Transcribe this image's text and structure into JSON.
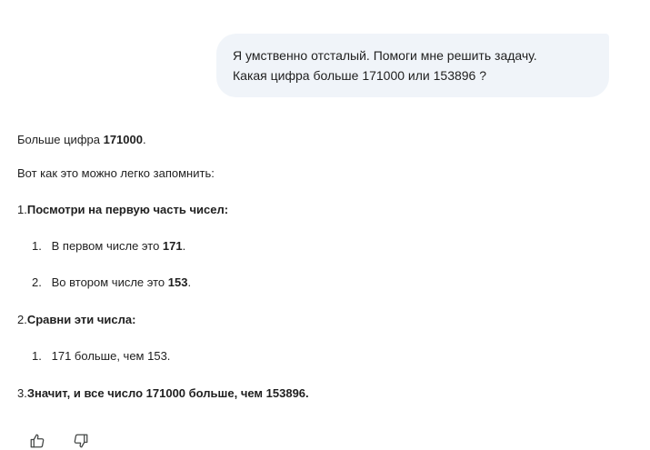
{
  "user_message": {
    "line1": "Я умственно отсталый. Помоги мне решить задачу.",
    "line2": "Какая цифра больше 171000 или 153896 ?"
  },
  "response": {
    "answer_prefix": "Больше цифра ",
    "answer_value": "171000",
    "answer_suffix": ".",
    "intro": "Вот как это можно легко запомнить:",
    "step1": {
      "num": "1. ",
      "title": "Посмотри на первую часть чисел:",
      "items": [
        {
          "num": "1.",
          "prefix": "В первом числе это ",
          "value": "171",
          "suffix": "."
        },
        {
          "num": "2.",
          "prefix": "Во втором числе это ",
          "value": "153",
          "suffix": "."
        }
      ]
    },
    "step2": {
      "num": "2. ",
      "title": "Сравни эти числа:",
      "items": [
        {
          "num": "1.",
          "text": "171 больше, чем 153."
        }
      ]
    },
    "step3": {
      "num": "3. ",
      "title": "Значит, и все число 171000 больше, чем 153896."
    }
  },
  "feedback": {
    "like_icon": "thumbs-up-icon",
    "dislike_icon": "thumbs-down-icon"
  }
}
